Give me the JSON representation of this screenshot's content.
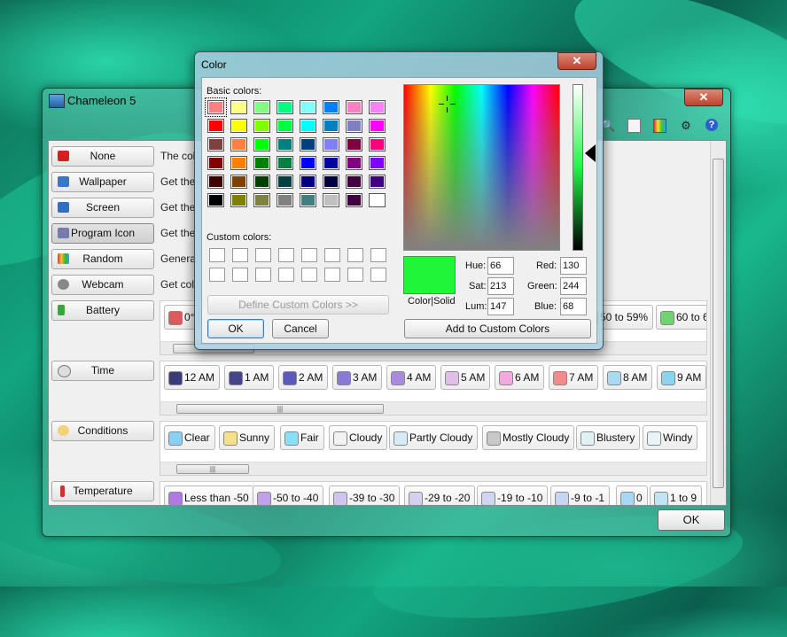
{
  "main_window": {
    "title": "Chameleon 5",
    "close_label": "✕",
    "toolbar_icons": [
      "search-icon",
      "clipboard-icon",
      "palette-icon",
      "gear-icon",
      "help-icon"
    ],
    "help_glyph": "?",
    "ok_label": "OK"
  },
  "sidebar": {
    "items": [
      {
        "label": "None",
        "icon": "red-x-icon",
        "color": "#d42020"
      },
      {
        "label": "Wallpaper",
        "icon": "wallpaper-icon",
        "color": "#3a76c8"
      },
      {
        "label": "Screen",
        "icon": "monitor-icon",
        "color": "#2d6fc1"
      },
      {
        "label": "Program Icon",
        "icon": "program-icon",
        "color": "#7a7ab0"
      },
      {
        "label": "Random",
        "icon": "rainbow-icon",
        "color": "#e0a030"
      },
      {
        "label": "Webcam",
        "icon": "webcam-icon",
        "color": "#888888"
      },
      {
        "label": "Battery",
        "icon": "battery-icon",
        "color": "#3aa53a"
      },
      {
        "label": "Time",
        "icon": "clock-icon",
        "color": "#999999"
      },
      {
        "label": "Conditions",
        "icon": "cloud-sun-icon",
        "color": "#e0b040"
      },
      {
        "label": "Temperature",
        "icon": "thermometer-icon",
        "color": "#d03030"
      }
    ],
    "selected": "Program Icon"
  },
  "descriptions": [
    "The col",
    "Get the",
    "Get the",
    "Get the",
    "Genera",
    "Get col"
  ],
  "battery_strip": {
    "chips": [
      {
        "label": "0°",
        "color": "#e05a5a"
      },
      {
        "label": "50 to 59%",
        "color": "#9ed98c"
      },
      {
        "label": "60 to 6",
        "color": "#6fd46f"
      }
    ]
  },
  "time_strip": {
    "chips": [
      {
        "label": "12 AM",
        "color": "#3a3a7a"
      },
      {
        "label": "1 AM",
        "color": "#45458a"
      },
      {
        "label": "2 AM",
        "color": "#5a5ab8"
      },
      {
        "label": "3 AM",
        "color": "#8a7ad6"
      },
      {
        "label": "4 AM",
        "color": "#a98ae0"
      },
      {
        "label": "5 AM",
        "color": "#e0bfe6"
      },
      {
        "label": "6 AM",
        "color": "#f4a8dc"
      },
      {
        "label": "7 AM",
        "color": "#f48a8a"
      },
      {
        "label": "8 AM",
        "color": "#a8daf4"
      },
      {
        "label": "9 AM",
        "color": "#8ad4f0"
      }
    ]
  },
  "conditions_strip": {
    "chips": [
      {
        "label": "Clear",
        "color": "#8ad0f4"
      },
      {
        "label": "Sunny",
        "color": "#f6e08a"
      },
      {
        "label": "Fair",
        "color": "#8ae0f6"
      },
      {
        "label": "Cloudy",
        "color": "#f2f2f2"
      },
      {
        "label": "Partly Cloudy",
        "color": "#d6ecf4"
      },
      {
        "label": "Mostly Cloudy",
        "color": "#c8c8c8"
      },
      {
        "label": "Blustery",
        "color": "#e0f2f6"
      },
      {
        "label": "Windy",
        "color": "#e8f4f8"
      }
    ]
  },
  "temperature_strip": {
    "chips": [
      {
        "label": "Less than -50",
        "color": "#b07ae0"
      },
      {
        "label": "-50 to -40",
        "color": "#c2a0ea"
      },
      {
        "label": "-39 to -30",
        "color": "#cfc4ee"
      },
      {
        "label": "-29 to -20",
        "color": "#d4d0ee"
      },
      {
        "label": "-19 to -10",
        "color": "#d0d6f0"
      },
      {
        "label": "-9 to -1",
        "color": "#c6d6f0"
      },
      {
        "label": "0",
        "color": "#a8d8f4"
      },
      {
        "label": "1 to 9",
        "color": "#c0e6f6"
      }
    ]
  },
  "color_dialog": {
    "title": "Color",
    "close_label": "✕",
    "basic_colors_label": "Basic colors:",
    "custom_colors_label": "Custom colors:",
    "basic_colors": [
      "#ff8080",
      "#ffff80",
      "#80ff80",
      "#00ff80",
      "#80ffff",
      "#0080ff",
      "#ff80c0",
      "#ff80ff",
      "#ff0000",
      "#ffff00",
      "#80ff00",
      "#00ff40",
      "#00ffff",
      "#0080c0",
      "#8080c0",
      "#ff00ff",
      "#804040",
      "#ff8040",
      "#00ff00",
      "#008080",
      "#004080",
      "#8080ff",
      "#800040",
      "#ff0080",
      "#800000",
      "#ff8000",
      "#008000",
      "#008040",
      "#0000ff",
      "#0000a0",
      "#800080",
      "#8000ff",
      "#400000",
      "#804000",
      "#004000",
      "#004040",
      "#000080",
      "#000040",
      "#400040",
      "#400080",
      "#000000",
      "#808000",
      "#808040",
      "#808080",
      "#408080",
      "#c0c0c0",
      "#400040",
      "#ffffff"
    ],
    "define_custom_label": "Define Custom Colors >>",
    "ok_label": "OK",
    "cancel_label": "Cancel",
    "color_solid_label": "Color|Solid",
    "hue_label": "Hue:",
    "hue": "66",
    "sat_label": "Sat:",
    "sat": "213",
    "lum_label": "Lum:",
    "lum": "147",
    "red_label": "Red:",
    "red": "130",
    "green_label": "Green:",
    "green": "244",
    "blue_label": "Blue:",
    "blue": "68",
    "add_custom_label": "Add to Custom Colors",
    "current_color": "#20f53a"
  }
}
